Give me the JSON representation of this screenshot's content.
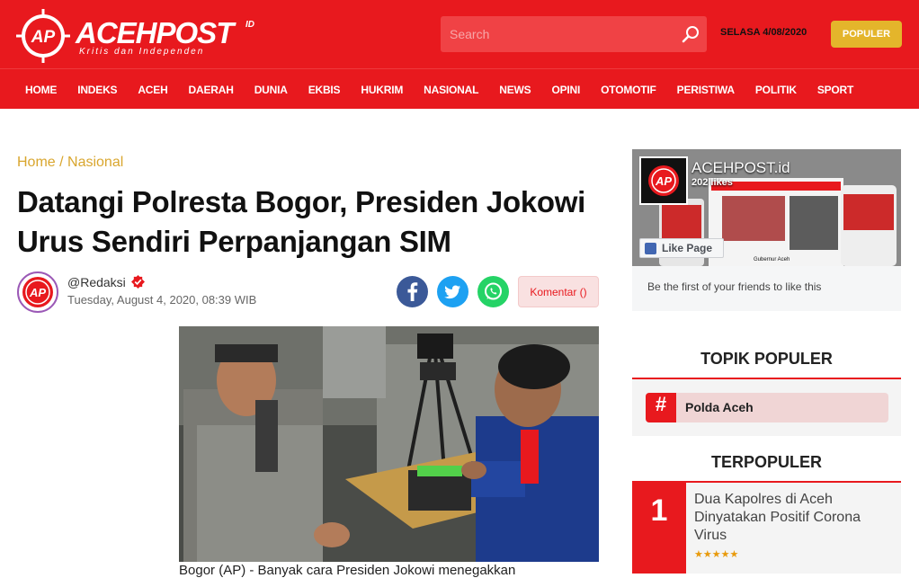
{
  "header": {
    "logo_text": "ACEHPOST",
    "logo_suffix": "ID",
    "logo_tagline": "Kritis dan Independen",
    "logo_mark": "AP",
    "search_placeholder": "Search",
    "date": "SELASA 4/08/2020",
    "populer_button": "POPULER",
    "accent_color": "#e8191e"
  },
  "nav": {
    "items": [
      "HOME",
      "INDEKS",
      "ACEH",
      "DAERAH",
      "DUNIA",
      "EKBIS",
      "HUKRIM",
      "NASIONAL",
      "NEWS",
      "OPINI",
      "OTOMOTIF",
      "PERISTIWA",
      "POLITIK",
      "SPORT"
    ]
  },
  "article": {
    "breadcrumb": "Home / Nasional",
    "title": "Datangi Polresta Bogor, Presiden Jokowi Urus Sendiri Perpanjangan SIM",
    "author": "@Redaksi",
    "published": "Tuesday, August 4, 2020, 08:39 WIB",
    "comment_button": "Komentar ()",
    "share_icons": [
      "facebook-icon",
      "twitter-icon",
      "whatsapp-icon"
    ],
    "caption": "Bogor (AP) - Banyak cara Presiden Jokowi menegakkan"
  },
  "sidebar": {
    "fb_page_name": "ACEHPOST.id",
    "fb_likes": "202 likes",
    "fb_like_button": "Like Page",
    "fb_friends_text": "Be the first of your friends to like this",
    "topik_title": "TOPIK POPULER",
    "topik_items": [
      {
        "hash": "#",
        "label": "Polda Aceh"
      }
    ],
    "terpopuler_title": "TERPOPULER",
    "terpopuler_items": [
      {
        "rank": "1",
        "title": "Dua Kapolres di Aceh Dinyatakan Positif Corona Virus",
        "stars": "★★★★★"
      }
    ]
  }
}
